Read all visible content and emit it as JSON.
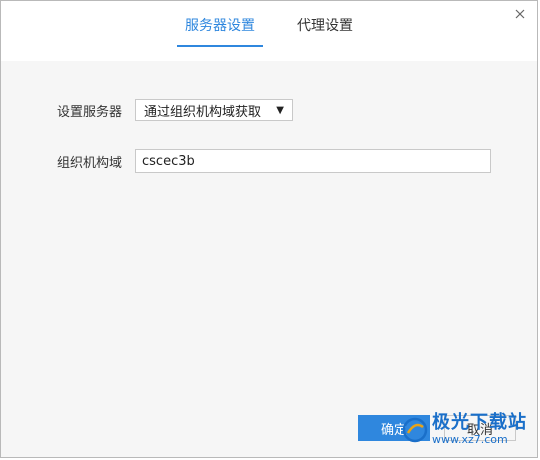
{
  "dialog": {
    "close_icon": "close-icon"
  },
  "tabs": [
    {
      "label": "服务器设置",
      "active": true
    },
    {
      "label": "代理设置",
      "active": false
    }
  ],
  "form": {
    "server_label": "设置服务器",
    "server_select_value": "通过组织机构域获取",
    "org_label": "组织机构域",
    "org_value": "cscec3b"
  },
  "buttons": {
    "confirm_label": "确定",
    "cancel_label": "取消"
  },
  "watermark": {
    "main_text": "极光下载站",
    "sub_text": "www.xz7.com"
  },
  "colors": {
    "accent": "#2f87de",
    "watermark": "#1a6fc9"
  }
}
